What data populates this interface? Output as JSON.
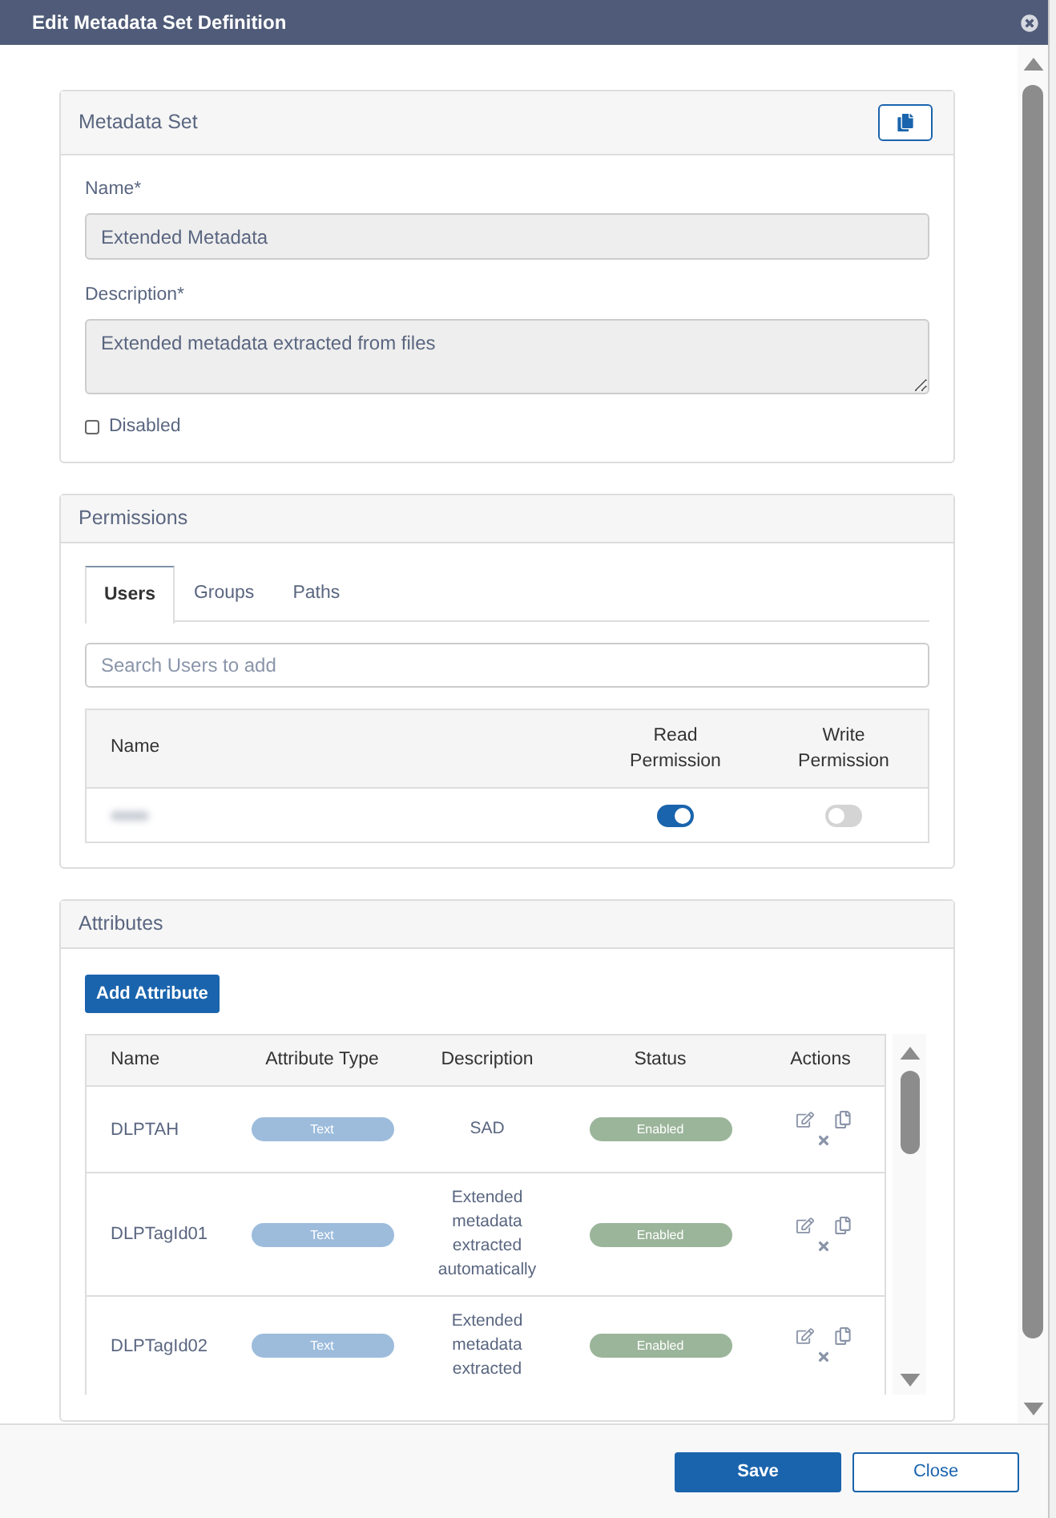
{
  "window": {
    "title": "Edit Metadata Set Definition"
  },
  "metadata_set": {
    "title": "Metadata Set",
    "fields": [
      {
        "kind": "input",
        "label": "Name*",
        "value": "Extended Metadata"
      },
      {
        "kind": "textarea",
        "label": "Description*",
        "value": "Extended metadata extracted from files"
      }
    ],
    "disabled": {
      "label": "Disabled",
      "checked": false
    }
  },
  "permissions": {
    "title": "Permissions",
    "tabs": [
      {
        "label": "Users",
        "selected": true
      },
      {
        "label": "Groups",
        "selected": false
      },
      {
        "label": "Paths",
        "selected": false
      }
    ],
    "search": {
      "placeholder": "Search Users to add"
    },
    "columns": [
      "Name",
      "Read Permission",
      "Write Permission"
    ],
    "rows": [
      {
        "read": true,
        "write": false
      }
    ]
  },
  "attributes": {
    "title": "Attributes",
    "add_button": "Add Attribute",
    "columns": [
      "Name",
      "Attribute Type",
      "Description",
      "Status",
      "Actions"
    ],
    "rows": [
      {
        "name": "DLPTAH",
        "type": "Text",
        "description": "SAD",
        "status": "Enabled"
      },
      {
        "name": "DLPTagId01",
        "type": "Text",
        "description": "Extended metadata extracted automatically",
        "status": "Enabled"
      },
      {
        "name": "DLPTagId02",
        "type": "Text",
        "description": "Extended metadata extracted",
        "status": "Enabled"
      }
    ]
  },
  "footer": {
    "buttons": [
      {
        "kind": "primary",
        "label": "Save"
      },
      {
        "kind": "secondary",
        "label": "Close"
      }
    ]
  }
}
